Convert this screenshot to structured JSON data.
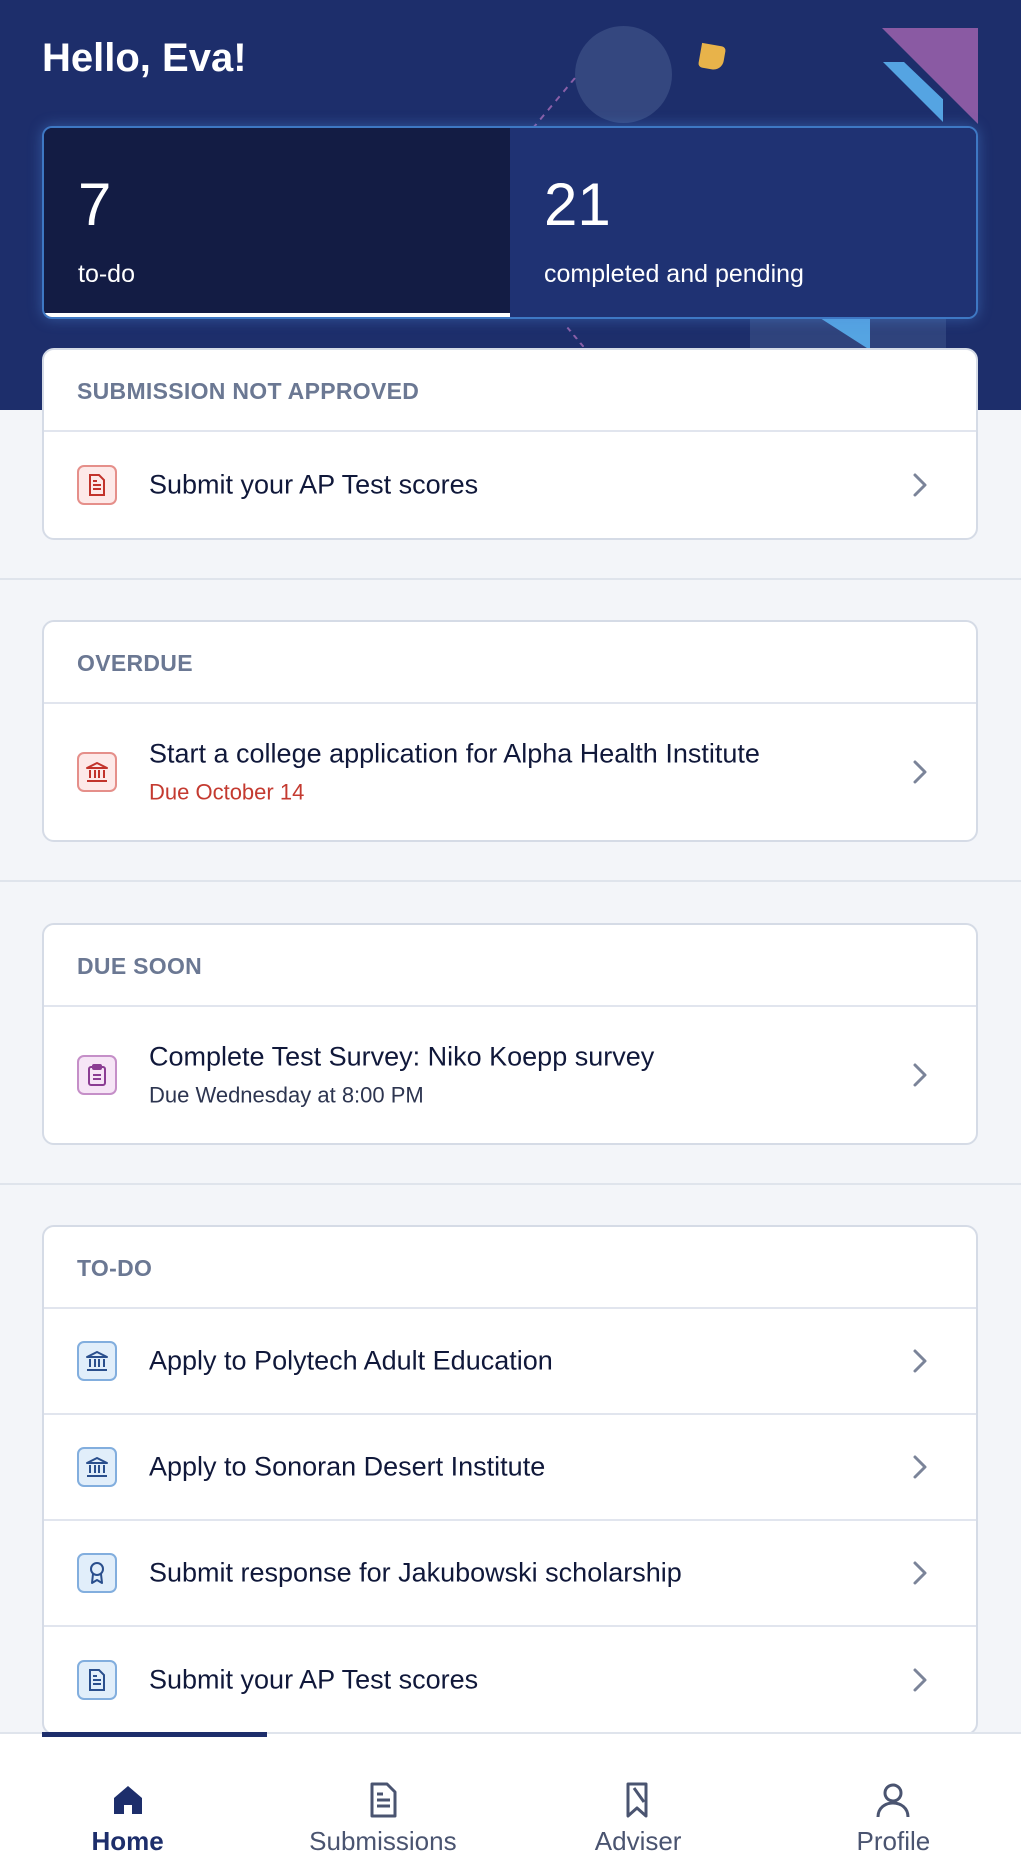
{
  "header": {
    "greeting": "Hello, Eva!"
  },
  "stats": {
    "todo": {
      "count": "7",
      "label": "to-do"
    },
    "completed": {
      "count": "21",
      "label": "completed and pending"
    }
  },
  "sections": {
    "not_approved": {
      "heading": "SUBMISSION NOT APPROVED",
      "items": [
        {
          "title": "Submit your AP Test scores",
          "icon": "document-icon"
        }
      ]
    },
    "overdue": {
      "heading": "OVERDUE",
      "items": [
        {
          "title": "Start a college application for Alpha Health Institute",
          "subtitle": "Due October 14",
          "icon": "institution-icon"
        }
      ]
    },
    "due_soon": {
      "heading": "DUE SOON",
      "items": [
        {
          "title": "Complete Test Survey: Niko Koepp survey",
          "subtitle": "Due Wednesday at 8:00 PM",
          "icon": "clipboard-icon"
        }
      ]
    },
    "todo": {
      "heading": "TO-DO",
      "items": [
        {
          "title": "Apply to Polytech Adult Education",
          "icon": "institution-icon"
        },
        {
          "title": "Apply to Sonoran Desert Institute",
          "icon": "institution-icon"
        },
        {
          "title": "Submit response for Jakubowski scholarship",
          "icon": "award-icon"
        },
        {
          "title": "Submit your AP Test scores",
          "icon": "document-icon"
        }
      ]
    }
  },
  "nav": {
    "items": [
      {
        "label": "Home",
        "icon": "home-icon",
        "active": true
      },
      {
        "label": "Submissions",
        "icon": "document-icon",
        "active": false
      },
      {
        "label": "Adviser",
        "icon": "bookmark-icon",
        "active": false
      },
      {
        "label": "Profile",
        "icon": "person-icon",
        "active": false
      }
    ]
  },
  "colors": {
    "hero": "#1d2e6b",
    "todo_stat": "#131c44",
    "overdue_red": "#c43a30",
    "background": "#f3f5f9"
  }
}
